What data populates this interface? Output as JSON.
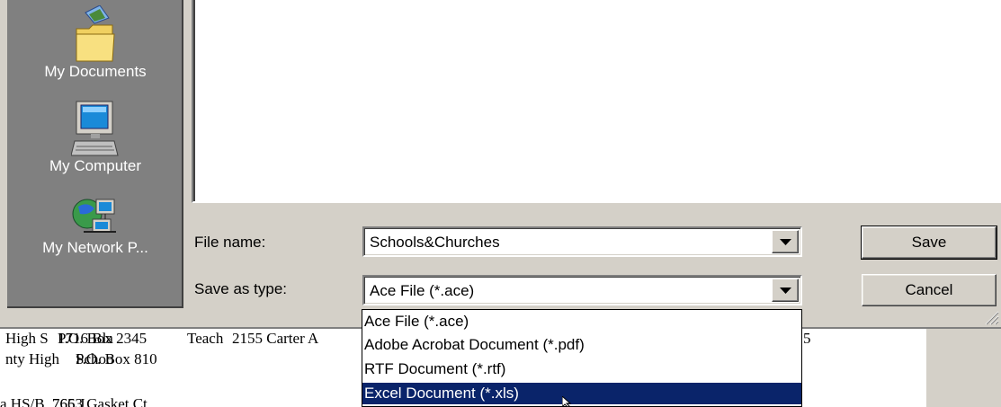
{
  "places_bar": {
    "items": [
      {
        "label": "My Documents",
        "icon": "folder-documents-icon"
      },
      {
        "label": "My Computer",
        "icon": "computer-icon"
      },
      {
        "label": "My Network P...",
        "icon": "network-places-icon"
      }
    ]
  },
  "form": {
    "file_name_label": "File name:",
    "file_name_value": "Schools&Churches",
    "save_as_type_label": "Save as type:",
    "save_as_type_value": "Ace File (*.ace)"
  },
  "buttons": {
    "save": "Save",
    "cancel": "Cancel"
  },
  "type_dropdown": {
    "options": [
      "Ace File (*.ace)",
      "Adobe Acrobat Document (*.pdf)",
      "RTF Document (*.rtf)",
      "Excel Document (*.xls)"
    ],
    "selected_index": 3,
    "highlight_color": "#0a246a"
  },
  "background_document": {
    "lines": [
      {
        "a": "High S",
        "b": "P.O. Box 2345",
        "c": "Teach",
        "d": "2155 Carter A",
        "e": "5"
      },
      {
        "a": "nty High",
        "b": "P.O. Box 810"
      },
      {
        "a": "a HS/B",
        "b": "7663 Gasket Ct."
      }
    ],
    "overlap_text": [
      "1716 Bla",
      "S",
      "Schoo",
      "765 J"
    ]
  },
  "colors": {
    "dialog_face": "#d4d0c8",
    "places_bar": "#808080",
    "selection": "#0a246a"
  }
}
